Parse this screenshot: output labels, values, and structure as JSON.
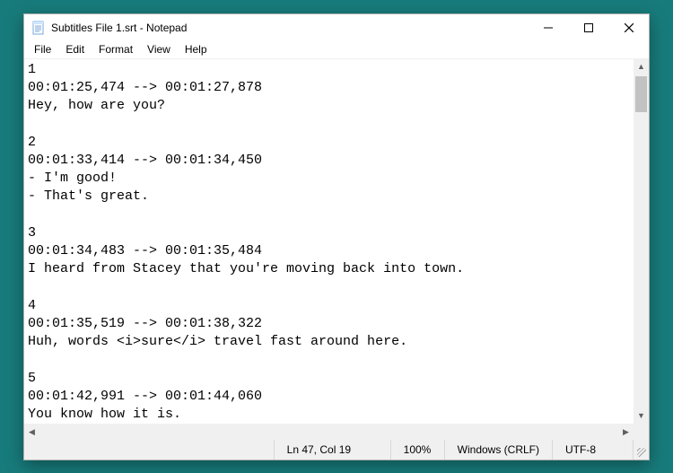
{
  "window": {
    "title": "Subtitles File 1.srt - Notepad"
  },
  "menu": {
    "items": [
      "File",
      "Edit",
      "Format",
      "View",
      "Help"
    ]
  },
  "content": {
    "text": "1\n00:01:25,474 --> 00:01:27,878\nHey, how are you?\n\n2\n00:01:33,414 --> 00:01:34,450\n- I'm good!\n- That's great.\n\n3\n00:01:34,483 --> 00:01:35,484\nI heard from Stacey that you're moving back into town.\n\n4\n00:01:35,519 --> 00:01:38,322\nHuh, words <i>sure</i> travel fast around here.\n\n5\n00:01:42,991 --> 00:01:44,060\nYou know how it is."
  },
  "status": {
    "position": "Ln 47, Col 19",
    "zoom": "100%",
    "line_ending": "Windows (CRLF)",
    "encoding": "UTF-8"
  }
}
